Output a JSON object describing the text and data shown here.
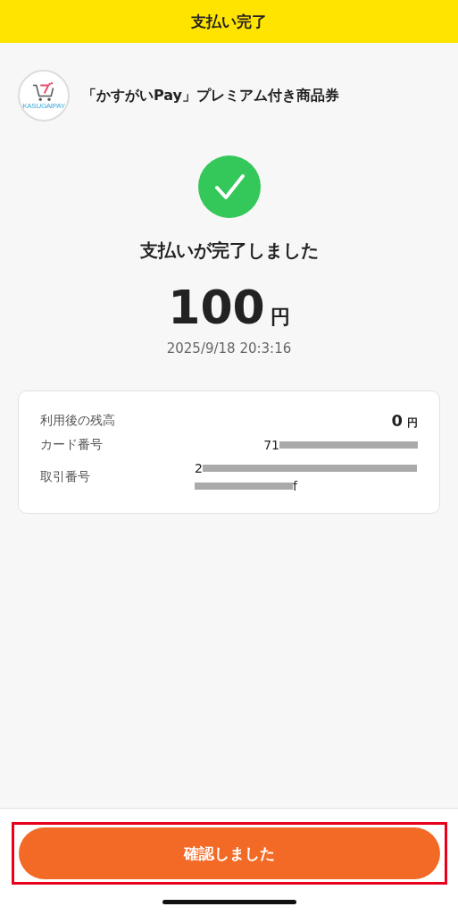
{
  "header": {
    "title": "支払い完了"
  },
  "merchant": {
    "logo_text": "KASUGAIPAY",
    "name": "「かすがいPay」プレミアム付き商品券"
  },
  "result": {
    "message": "支払いが完了しました",
    "amount": "100",
    "currency": "円",
    "datetime": "2025/9/18 20:3:16"
  },
  "details": [
    {
      "kind": "amount",
      "label": "利用後の残高",
      "value": "0",
      "unit": "円"
    },
    {
      "kind": "redacted",
      "label": "カード番号",
      "lines": [
        "71"
      ]
    },
    {
      "kind": "redacted",
      "label": "取引番号",
      "lines": [
        "2",
        "f"
      ]
    }
  ],
  "confirm_button": {
    "label": "確認しました",
    "highlighted": true
  }
}
